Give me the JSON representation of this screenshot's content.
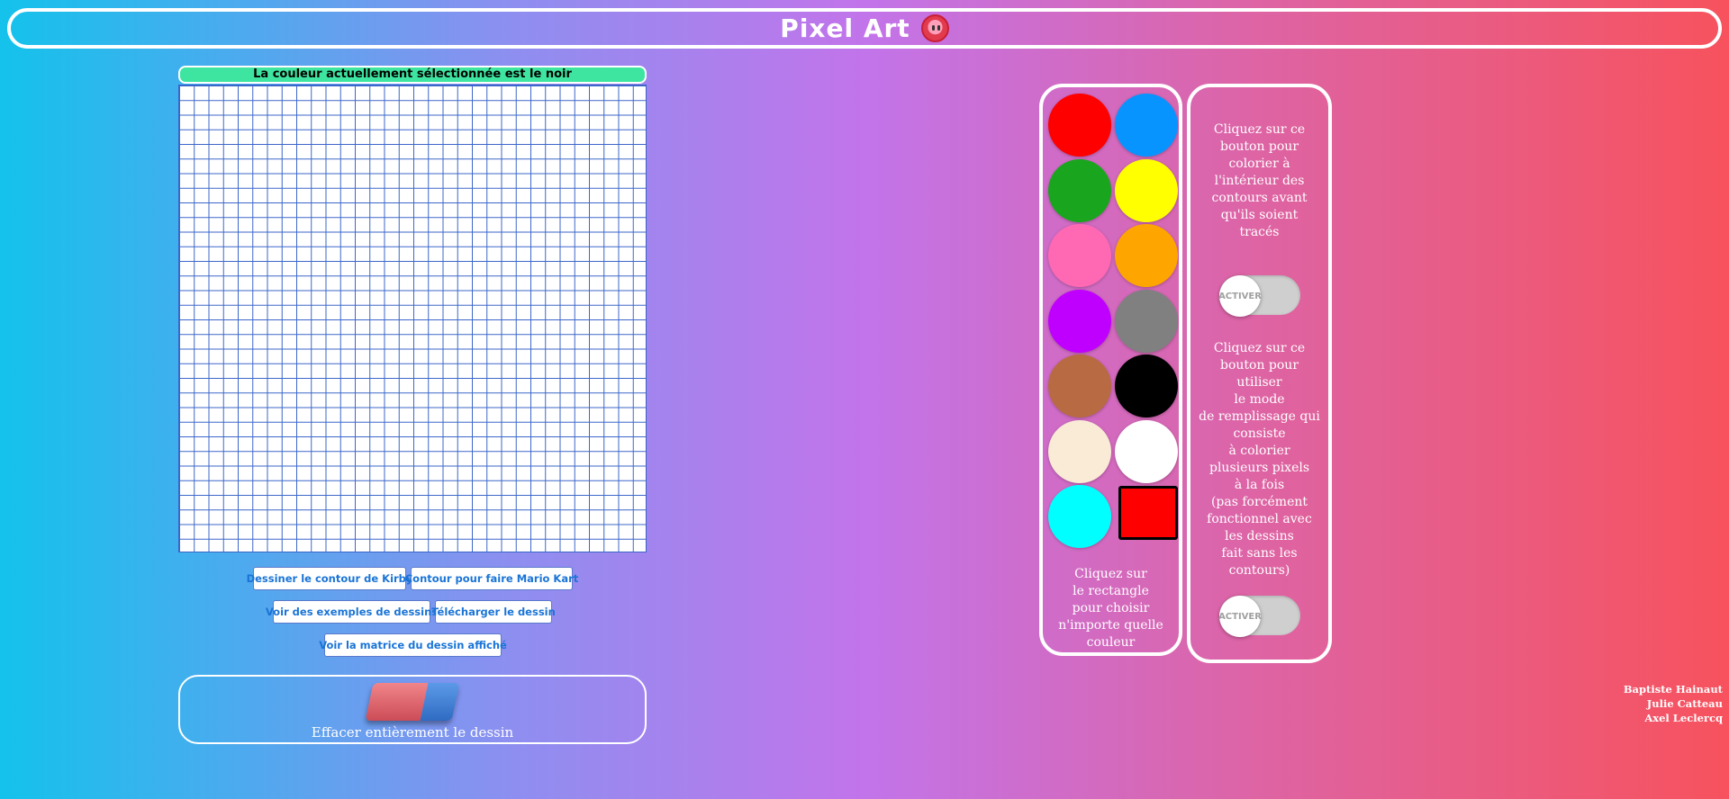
{
  "header": {
    "title": "Pixel Art",
    "icon": "kirby-icon"
  },
  "canvas": {
    "status": "La couleur actuellement sélectionnée est le noir",
    "status_color": "#3ee5a0",
    "grid_line_color": "#3a65c9",
    "grid_columns": 32,
    "grid_rows": 32
  },
  "actions": {
    "kirby": "Dessiner le contour de Kirby",
    "mario": "Contour pour faire Mario Kart",
    "examples": "Voir des exemples de dessins",
    "download": "Télécharger le dessin",
    "matrix": "Voir la matrice du dessin affiché"
  },
  "eraser": {
    "label": "Effacer entièrement le dessin",
    "icon": "eraser-icon"
  },
  "palette": {
    "swatches": [
      {
        "name": "red",
        "color": "#ff0000"
      },
      {
        "name": "blue",
        "color": "#0894ff"
      },
      {
        "name": "green",
        "color": "#1aa51e"
      },
      {
        "name": "yellow",
        "color": "#ffff00"
      },
      {
        "name": "pink",
        "color": "#ff69b4"
      },
      {
        "name": "orange",
        "color": "#ffa500"
      },
      {
        "name": "purple",
        "color": "#c000ff"
      },
      {
        "name": "gray",
        "color": "#808080"
      },
      {
        "name": "brown",
        "color": "#b86b42"
      },
      {
        "name": "black",
        "color": "#000000"
      },
      {
        "name": "beige",
        "color": "#f9ebd6"
      },
      {
        "name": "white",
        "color": "#ffffff"
      },
      {
        "name": "cyan",
        "color": "#00ffff"
      }
    ],
    "custom_color": "#ff0000",
    "hint": "Cliquez sur\nle rectangle\npour choisir\nn'importe quelle\ncouleur"
  },
  "options": {
    "outline_fill_text": "Cliquez sur ce\nbouton pour\ncolorier à\nl'intérieur des\ncontours avant\nqu'ils soient\ntracés",
    "outline_fill_toggle": "ACTIVER",
    "fill_mode_text": "Cliquez sur ce\nbouton pour\nutiliser\nle mode\nde remplissage qui\nconsiste\nà colorier\nplusieurs pixels\nà la fois\n(pas forcément\nfonctionnel avec\nles dessins\nfait sans les\ncontours)",
    "fill_mode_toggle": "ACTIVER"
  },
  "credits": [
    "Baptiste Hainaut",
    "Julie Catteau",
    "Axel Leclercq"
  ]
}
